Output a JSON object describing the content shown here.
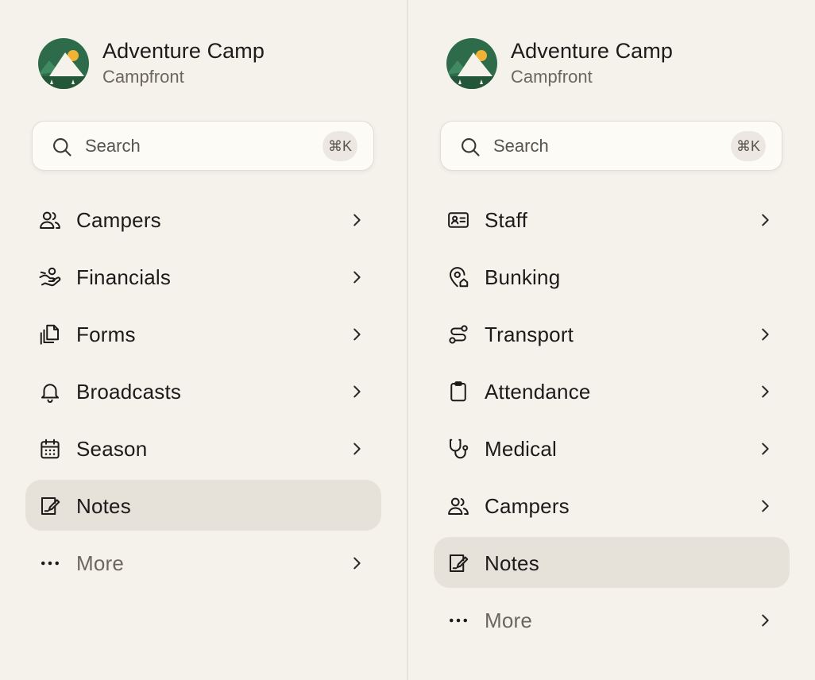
{
  "colors": {
    "background": "#f5f2ec",
    "active_bg": "#e6e2da",
    "logo_green": "#2e6b4a",
    "sun": "#f2b233"
  },
  "left": {
    "brand": {
      "title": "Adventure Camp",
      "subtitle": "Campfront"
    },
    "search": {
      "label": "Search",
      "shortcut": "⌘K"
    },
    "items": [
      {
        "label": "Campers",
        "icon": "users-icon"
      },
      {
        "label": "Financials",
        "icon": "hand-coins-icon"
      },
      {
        "label": "Forms",
        "icon": "documents-icon"
      },
      {
        "label": "Broadcasts",
        "icon": "bell-icon"
      },
      {
        "label": "Season",
        "icon": "calendar-icon"
      },
      {
        "label": "Notes",
        "icon": "note-edit-icon",
        "active": true
      },
      {
        "label": "More",
        "icon": "ellipsis-icon"
      }
    ]
  },
  "right": {
    "brand": {
      "title": "Adventure Camp",
      "subtitle": "Campfront"
    },
    "search": {
      "label": "Search",
      "shortcut": "⌘K"
    },
    "items": [
      {
        "label": "Staff",
        "icon": "id-card-icon"
      },
      {
        "label": "Bunking",
        "icon": "location-home-icon"
      },
      {
        "label": "Transport",
        "icon": "route-icon"
      },
      {
        "label": "Attendance",
        "icon": "clipboard-icon"
      },
      {
        "label": "Medical",
        "icon": "stethoscope-icon"
      },
      {
        "label": "Campers",
        "icon": "users-icon"
      },
      {
        "label": "Notes",
        "icon": "note-edit-icon",
        "active": true
      },
      {
        "label": "More",
        "icon": "ellipsis-icon"
      }
    ]
  }
}
